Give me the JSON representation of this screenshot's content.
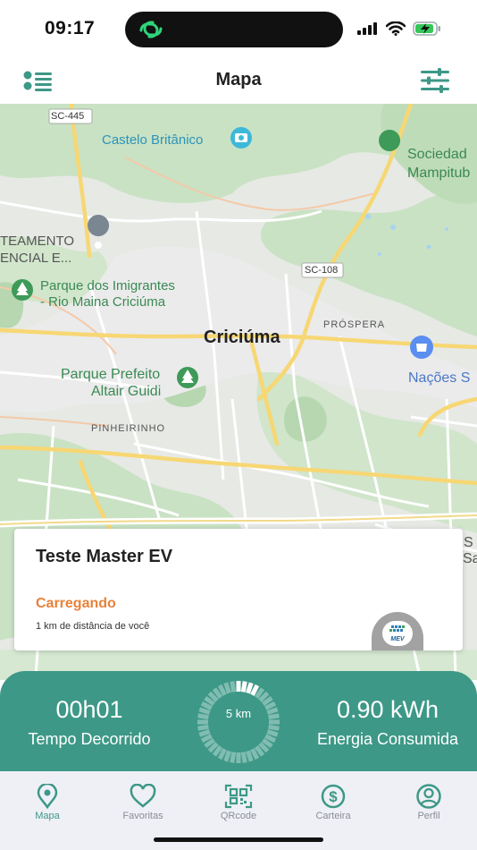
{
  "status_bar": {
    "time": "09:17"
  },
  "header": {
    "title": "Mapa"
  },
  "map": {
    "labels": {
      "sc445": "SC-445",
      "castelo": "Castelo Britânico",
      "sociedade_1": "Sociedad",
      "sociedade_2": "Mampitub",
      "loteamento_1": "TEAMENTO",
      "loteamento_2": "ENCIAL E...",
      "sc108": "SC-108",
      "parque_imigrantes_1": "Parque dos Imigrantes",
      "parque_imigrantes_2": "- Rio Maina Criciúma",
      "prospera": "PRÓSPERA",
      "criciuma": "Criciúma",
      "nacoes": "Nações S",
      "parque_prefeito_1": "Parque Prefeito",
      "parque_prefeito_2": "Altair Guidi",
      "pinheirinho": "PINHEIRINHO",
      "edge_1": "S",
      "edge_2": "Sa"
    }
  },
  "station_card": {
    "title": "Teste Master EV",
    "status": "Carregando",
    "distance": "1 km de distância de você",
    "logo_text": "MEV"
  },
  "session": {
    "elapsed_value": "00h01",
    "elapsed_label": "Tempo Decorrido",
    "ring_text": "5 km",
    "energy_value": "0.90 kWh",
    "energy_label": "Energia Consumida"
  },
  "tabs": [
    {
      "label": "Mapa"
    },
    {
      "label": "Favoritas"
    },
    {
      "label": "QRcode"
    },
    {
      "label": "Carteira"
    },
    {
      "label": "Perfil"
    }
  ],
  "colors": {
    "accent": "#3d9887",
    "charging_status": "#e8823a",
    "tab_inactive": "#8a8d93"
  }
}
